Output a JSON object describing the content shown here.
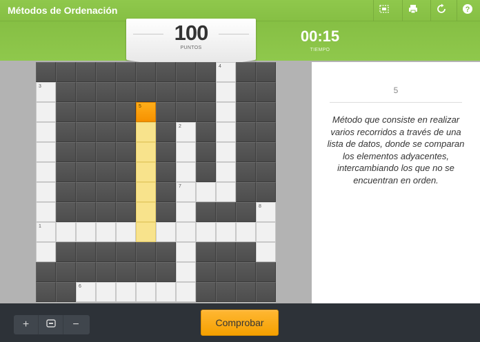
{
  "app": {
    "title": "Métodos de Ordenación"
  },
  "toolbar": {
    "icons": [
      "fullscreen-icon",
      "print-icon",
      "reset-icon",
      "help-icon"
    ]
  },
  "score": {
    "value": "100",
    "label": "PUNTOS"
  },
  "timer": {
    "value": "00:15",
    "label": "TIEMPO"
  },
  "grid": {
    "cols": 12,
    "rows": 12,
    "white_cells": [
      [
        0,
        9
      ],
      [
        1,
        0
      ],
      [
        1,
        9
      ],
      [
        2,
        0
      ],
      [
        2,
        9
      ],
      [
        3,
        0
      ],
      [
        3,
        7
      ],
      [
        3,
        9
      ],
      [
        4,
        0
      ],
      [
        4,
        7
      ],
      [
        4,
        9
      ],
      [
        5,
        0
      ],
      [
        5,
        7
      ],
      [
        5,
        9
      ],
      [
        6,
        0
      ],
      [
        6,
        7
      ],
      [
        6,
        8
      ],
      [
        6,
        9
      ],
      [
        7,
        0
      ],
      [
        7,
        7
      ],
      [
        7,
        11
      ],
      [
        8,
        0
      ],
      [
        8,
        1
      ],
      [
        8,
        2
      ],
      [
        8,
        3
      ],
      [
        8,
        4
      ],
      [
        8,
        6
      ],
      [
        8,
        7
      ],
      [
        8,
        8
      ],
      [
        8,
        9
      ],
      [
        8,
        10
      ],
      [
        8,
        11
      ],
      [
        9,
        0
      ],
      [
        9,
        7
      ],
      [
        9,
        11
      ],
      [
        10,
        7
      ],
      [
        11,
        2
      ],
      [
        11,
        3
      ],
      [
        11,
        4
      ],
      [
        11,
        5
      ],
      [
        11,
        6
      ],
      [
        11,
        7
      ]
    ],
    "yellow_cells": [
      [
        3,
        5
      ],
      [
        4,
        5
      ],
      [
        5,
        5
      ],
      [
        6,
        5
      ],
      [
        7,
        5
      ],
      [
        8,
        5
      ]
    ],
    "orange_cells": [
      [
        2,
        5
      ]
    ],
    "numbers": [
      {
        "row": 0,
        "col": 9,
        "n": "4"
      },
      {
        "row": 1,
        "col": 0,
        "n": "3"
      },
      {
        "row": 2,
        "col": 5,
        "n": "5"
      },
      {
        "row": 3,
        "col": 7,
        "n": "2"
      },
      {
        "row": 6,
        "col": 7,
        "n": "7"
      },
      {
        "row": 7,
        "col": 11,
        "n": "8"
      },
      {
        "row": 8,
        "col": 0,
        "n": "1"
      },
      {
        "row": 11,
        "col": 2,
        "n": "6"
      }
    ]
  },
  "clue": {
    "number": "5",
    "text": "Método que consiste en realizar varios recorridos a través de una lista de datos, donde se comparan los elementos adyacentes, intercambiando los que no se encuentran en orden."
  },
  "controls": {
    "zoom_in": "+",
    "zoom_reset_icon": "fit-icon",
    "zoom_out": "−",
    "check_label": "Comprobar"
  },
  "colors": {
    "header_green": "#8bc34a",
    "orange": "#f69100",
    "yellow": "#f8e38c",
    "dark_cell": "#555555",
    "bottom_bar": "#2d3238"
  }
}
